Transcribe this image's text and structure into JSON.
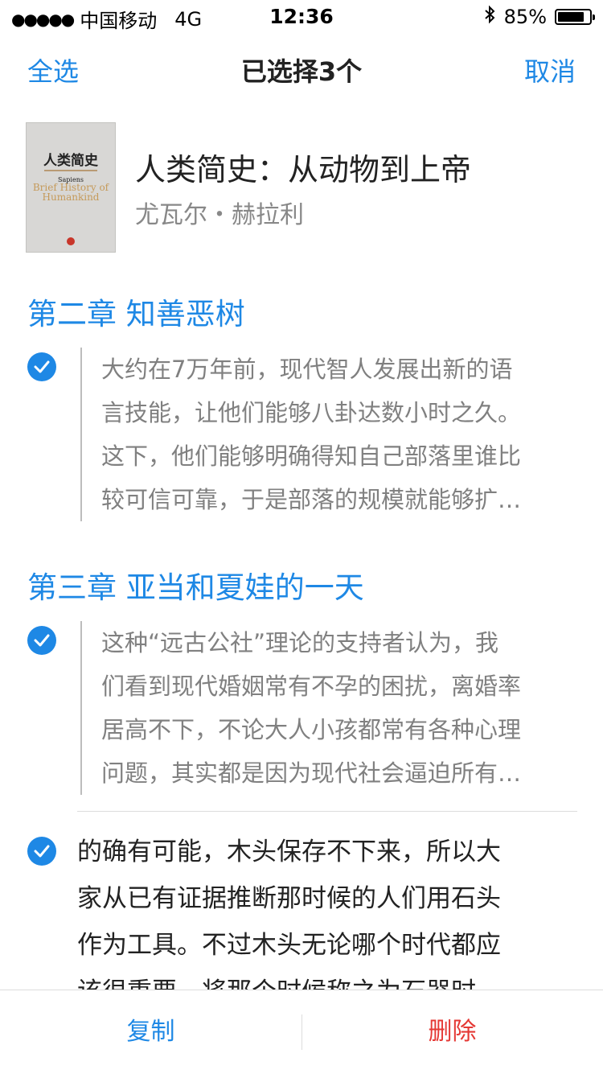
{
  "status_bar": {
    "signal": "●●●●●",
    "carrier": "中国移动",
    "network": "4G",
    "time": "12:36",
    "bluetooth_icon": "bluetooth-icon",
    "battery_text": "85%",
    "battery_level": 0.85
  },
  "nav": {
    "select_all": "全选",
    "title": "已选择3个",
    "cancel": "取消"
  },
  "book": {
    "title": "人类简史：从动物到上帝",
    "author": "尤瓦尔・赫拉利",
    "cover": {
      "title": "人类简史",
      "subtitle": "Sapiens",
      "english": "Brief History of Humankind"
    }
  },
  "chapters": [
    {
      "title": "第二章 知善恶树",
      "quote_lines": [
        "大约在7万年前，现代智人发展出新的语",
        "言技能，让他们能够八卦达数小时之久。",
        "这下，他们能够明确得知自己部落里谁比",
        "较可信可靠，于是部落的规模就能够扩…"
      ]
    },
    {
      "title": "第三章 亚当和夏娃的一天",
      "quote_lines": [
        "这种“远古公社”理论的支持者认为，我",
        "们看到现代婚姻常有不孕的困扰，离婚率",
        "居高不下，不论大人小孩都常有各种心理",
        "问题，其实都是因为现代社会逼迫所有…"
      ],
      "note_lines": [
        "的确有可能，木头保存不下来，所以大",
        "家从已有证据推断那时候的人们用石头",
        "作为工具。不过木头无论哪个时代都应",
        "该很重要，将那个时候称之为石器时"
      ]
    }
  ],
  "toolbar": {
    "copy": "复制",
    "delete": "删除"
  },
  "colors": {
    "accent": "#1e88e5",
    "danger": "#e53935"
  }
}
